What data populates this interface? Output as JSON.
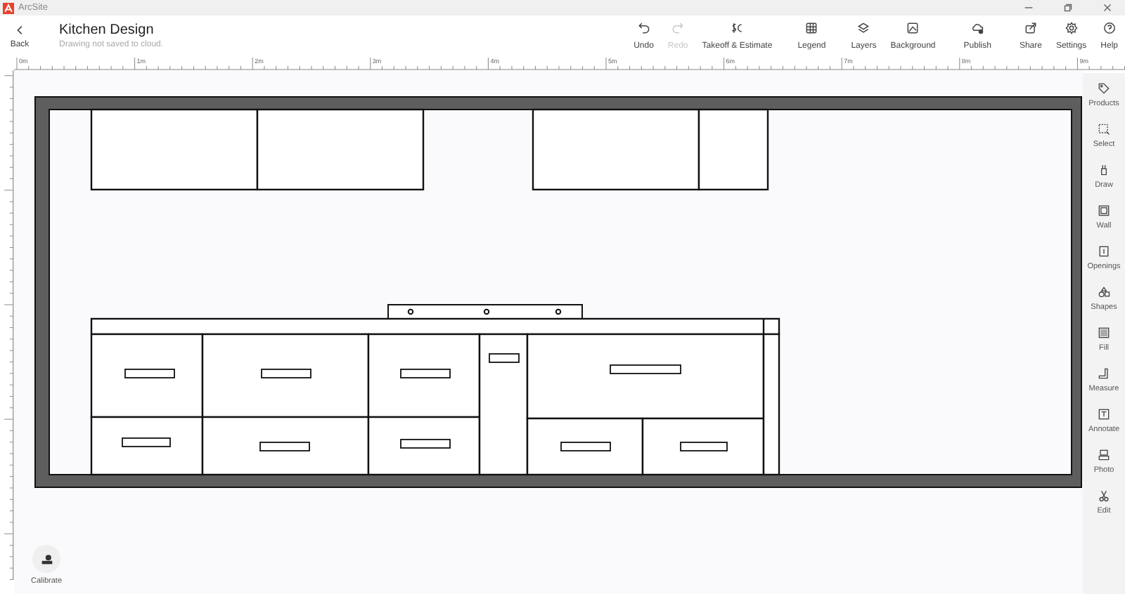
{
  "window": {
    "title": "ArcSite"
  },
  "header": {
    "back_label": "Back",
    "title": "Kitchen Design",
    "subtitle": "Drawing not saved to cloud."
  },
  "toolbar": [
    {
      "kind": "undo",
      "label": "Undo",
      "disabled": false
    },
    {
      "kind": "redo",
      "label": "Redo",
      "disabled": true
    },
    {
      "kind": "takeoff",
      "label": "Takeoff & Estimate",
      "disabled": false
    },
    {
      "kind": "legend",
      "label": "Legend",
      "disabled": false
    },
    {
      "kind": "layers",
      "label": "Layers",
      "disabled": false
    },
    {
      "kind": "background",
      "label": "Background",
      "disabled": false
    },
    {
      "kind": "publish",
      "label": "Publish",
      "disabled": false
    },
    {
      "kind": "share",
      "label": "Share",
      "disabled": false
    },
    {
      "kind": "settings",
      "label": "Settings",
      "disabled": false
    },
    {
      "kind": "help",
      "label": "Help",
      "disabled": false
    }
  ],
  "ruler": {
    "labels": [
      "0m",
      "1m",
      "2m",
      "3m",
      "4m",
      "5m",
      "6m",
      "7m",
      "8m",
      "9m"
    ]
  },
  "sidebar": {
    "items": [
      {
        "kind": "products",
        "label": "Products"
      },
      {
        "kind": "select",
        "label": "Select"
      },
      {
        "kind": "draw",
        "label": "Draw"
      },
      {
        "kind": "wall",
        "label": "Wall"
      },
      {
        "kind": "openings",
        "label": "Openings"
      },
      {
        "kind": "shapes",
        "label": "Shapes"
      },
      {
        "kind": "fill",
        "label": "Fill"
      },
      {
        "kind": "measure",
        "label": "Measure"
      },
      {
        "kind": "annotate",
        "label": "Annotate"
      },
      {
        "kind": "photo",
        "label": "Photo"
      },
      {
        "kind": "edit",
        "label": "Edit"
      }
    ]
  },
  "calibrate": {
    "label": "Calibrate"
  }
}
